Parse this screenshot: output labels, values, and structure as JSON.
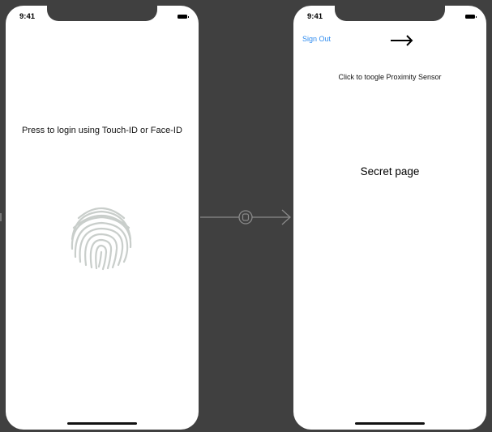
{
  "login_screen": {
    "status_time": "9:41",
    "prompt_label": "Press to login using Touch-ID or Face-ID",
    "fingerprint_icon": "fingerprint-icon"
  },
  "secret_screen": {
    "status_time": "9:41",
    "sign_out_label": "Sign Out",
    "sign_out_color": "#2f8cf0",
    "arrow_icon": "right-arrow-icon",
    "proximity_label": "Click to toogle Proximity Sensor",
    "title": "Secret page"
  },
  "canvas": {
    "background": "#404040",
    "segue_icon": "segue-connector-icon"
  }
}
